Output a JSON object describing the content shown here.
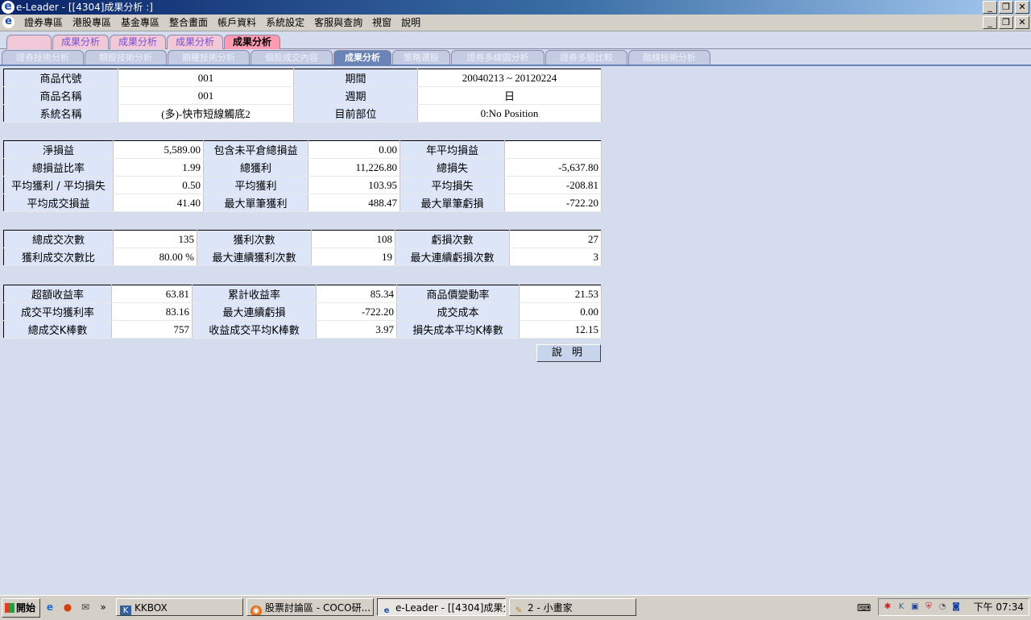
{
  "window": {
    "title": "e-Leader - [[4304]成果分析 :]"
  },
  "menu": [
    "證券專區",
    "港股專區",
    "基金專區",
    "整合畫面",
    "帳戶資料",
    "系統設定",
    "客服與查詢",
    "視窗",
    "說明"
  ],
  "tabs_row1": [
    "",
    "成果分析",
    "成果分析",
    "成果分析",
    "成果分析"
  ],
  "tabs_row2": [
    "證券技術分析",
    "類股技術分析",
    "期權技術分析",
    "個股成交內容",
    "成果分析",
    "策略選股",
    "證券多線圖分析",
    "證券多股比較",
    "融線技術分析"
  ],
  "info": {
    "l1": "商品代號",
    "v1": "001",
    "l2": "期間",
    "v2": "20040213 ~ 20120224",
    "l3": "商品名稱",
    "v3": "001",
    "l4": "週期",
    "v4": "日",
    "l5": "系統名稱",
    "v5": "(多)-快市短線觸底2",
    "l6": "目前部位",
    "v6": "0:No Position"
  },
  "pnl": [
    [
      "淨損益",
      "5,589.00",
      "包含未平倉總損益",
      "0.00",
      "年平均損益",
      ""
    ],
    [
      "總損益比率",
      "1.99",
      "總獲利",
      "11,226.80",
      "總損失",
      "-5,637.80"
    ],
    [
      "平均獲利 / 平均損失",
      "0.50",
      "平均獲利",
      "103.95",
      "平均損失",
      "-208.81"
    ],
    [
      "平均成交損益",
      "41.40",
      "最大單筆獲利",
      "488.47",
      "最大單筆虧損",
      "-722.20"
    ]
  ],
  "trades": [
    [
      "總成交次數",
      "135",
      "獲利次數",
      "108",
      "虧損次數",
      "27"
    ],
    [
      "獲利成交次數比",
      "80.00 %",
      "最大連續獲利次數",
      "19",
      "最大連續虧損次數",
      "3"
    ]
  ],
  "returns": [
    [
      "超額收益率",
      "63.81",
      "累計收益率",
      "85.34",
      "商品價變動率",
      "21.53"
    ],
    [
      "成交平均獲利率",
      "83.16",
      "最大連續虧損",
      "-722.20",
      "成交成本",
      "0.00"
    ],
    [
      "總成交K棒數",
      "757",
      "收益成交平均K棒數",
      "3.97",
      "損失成本平均K棒數",
      "12.15"
    ]
  ],
  "help_button": "說 明",
  "taskbar": {
    "start": "開始",
    "tasks": [
      "KKBOX",
      "股票討論區 - COCO研...",
      "e-Leader - [[4304]成果分...",
      "2 - 小畫家"
    ],
    "clock": "下午 07:34"
  }
}
